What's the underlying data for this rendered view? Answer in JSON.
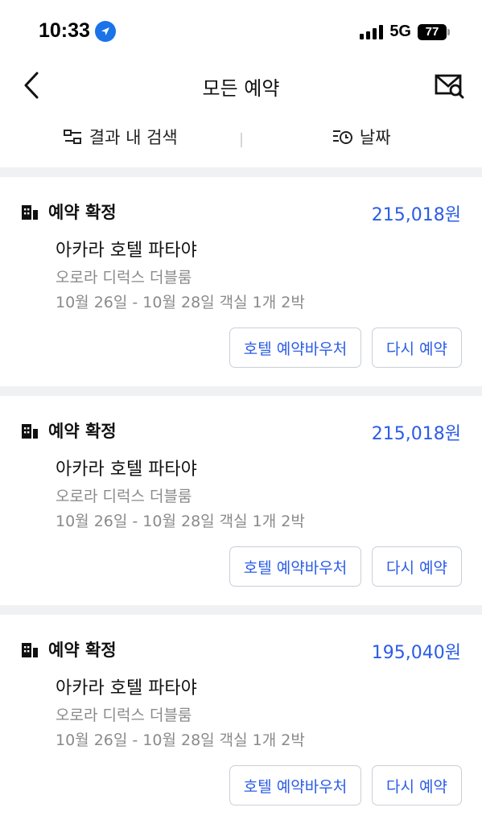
{
  "status_bar": {
    "time": "10:33",
    "network": "5G",
    "battery": "77"
  },
  "header": {
    "title": "모든 예약"
  },
  "filters": {
    "search_label": "결과 내 검색",
    "date_label": "날짜"
  },
  "colors": {
    "accent": "#2b5ce6",
    "secondary_text": "#8a8a8a",
    "separator": "#f0f1f3"
  },
  "reservations": [
    {
      "status": "예약 확정",
      "price": "215,018원",
      "hotel": "아카라 호텔 파타야",
      "room": "오로라 디럭스 더블룸",
      "dates": "10월 26일 - 10월 28일 객실 1개 2박",
      "voucher_label": "호텔 예약바우처",
      "rebook_label": "다시 예약"
    },
    {
      "status": "예약 확정",
      "price": "215,018원",
      "hotel": "아카라 호텔 파타야",
      "room": "오로라 디럭스 더블룸",
      "dates": "10월 26일 - 10월 28일 객실 1개 2박",
      "voucher_label": "호텔 예약바우처",
      "rebook_label": "다시 예약"
    },
    {
      "status": "예약 확정",
      "price": "195,040원",
      "hotel": "아카라 호텔 파타야",
      "room": "오로라 디럭스 더블룸",
      "dates": "10월 26일 - 10월 28일 객실 1개 2박",
      "voucher_label": "호텔 예약바우처",
      "rebook_label": "다시 예약"
    }
  ]
}
